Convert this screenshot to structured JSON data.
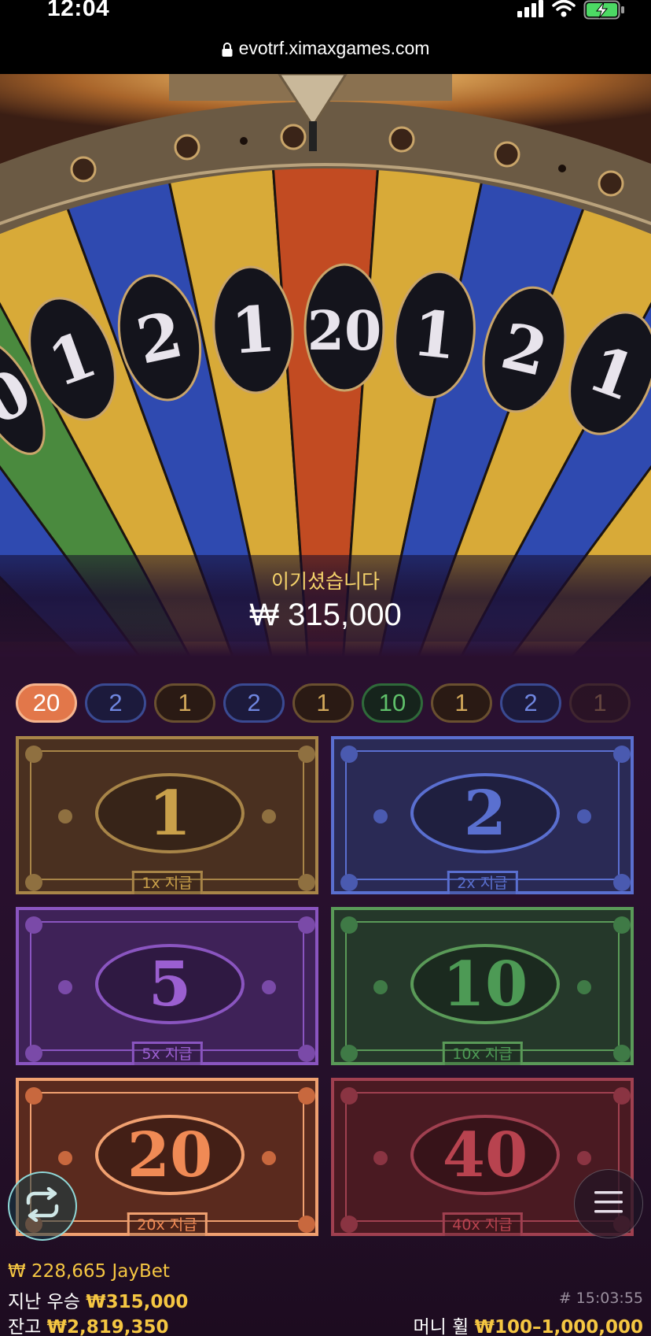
{
  "status_bar": {
    "time": "12:04",
    "url": "evotrf.ximaxgames.com"
  },
  "wheel": {
    "segment_numbers": [
      "0",
      "1",
      "2",
      "1",
      "20",
      "1",
      "2",
      "1"
    ]
  },
  "win": {
    "title": "이기셨습니다",
    "amount": "₩ 315,000"
  },
  "history": [
    {
      "value": "20",
      "color": "orange",
      "active": true
    },
    {
      "value": "2",
      "color": "blue"
    },
    {
      "value": "1",
      "color": "gold"
    },
    {
      "value": "2",
      "color": "blue"
    },
    {
      "value": "1",
      "color": "gold"
    },
    {
      "value": "10",
      "color": "green"
    },
    {
      "value": "1",
      "color": "gold"
    },
    {
      "value": "2",
      "color": "blue"
    },
    {
      "value": "1",
      "color": "gold",
      "faded": true
    }
  ],
  "bets": [
    {
      "number": "1",
      "payout": "1x 지급",
      "theme": "gold"
    },
    {
      "number": "2",
      "payout": "2x 지급",
      "theme": "blue"
    },
    {
      "number": "5",
      "payout": "5x 지급",
      "theme": "purple"
    },
    {
      "number": "10",
      "payout": "10x 지급",
      "theme": "green"
    },
    {
      "number": "20",
      "payout": "20x 지급",
      "theme": "orange"
    },
    {
      "number": "40",
      "payout": "40x 지급",
      "theme": "red"
    }
  ],
  "footer": {
    "balance_line": {
      "amount": "₩ 228,665",
      "brand": "JayBet"
    },
    "last_win": {
      "label": "지난 우승",
      "amount": "₩315,000"
    },
    "balance": {
      "label": "잔고",
      "amount": "₩2,819,350"
    },
    "round_id": "# 15:03:55",
    "bet_limits": {
      "label": "머니 휠",
      "range": "₩100–1,000,000"
    }
  },
  "colors": {
    "gold": "#c9a04a",
    "blue": "#5a6fd0",
    "purple": "#9b5fd0",
    "green": "#4d9a55",
    "orange": "#f08a55",
    "red": "#b8434f",
    "accent_yellow": "#f5c642"
  },
  "icons": [
    "lock-icon",
    "signal-icon",
    "wifi-icon",
    "battery-charging-icon",
    "repeat-icon",
    "menu-icon"
  ]
}
